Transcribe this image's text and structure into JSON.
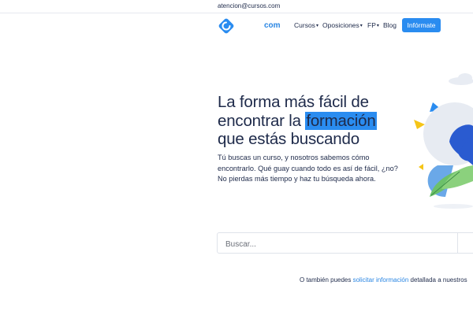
{
  "topbar": {
    "email": "atencion@cursos.com"
  },
  "header": {
    "brand": "com",
    "nav": [
      {
        "label": "Cursos",
        "has_dropdown": true
      },
      {
        "label": "Oposiciones",
        "has_dropdown": true
      },
      {
        "label": "FP",
        "has_dropdown": true
      },
      {
        "label": "Blog",
        "has_dropdown": false
      }
    ],
    "cta_label": "Infórmate"
  },
  "hero": {
    "title_line1": "La forma más fácil de",
    "title_line2_pre": "encontrar la ",
    "title_highlight": "formación",
    "title_line3": "que estás buscando",
    "subtitle": "Tú buscas un curso, y nosotros sabemos cómo encontrarlo. Qué guay cuando todo es así de fácil, ¿no? No pierdas más tiempo y haz tu búsqueda ahora."
  },
  "search": {
    "placeholder": "Buscar..."
  },
  "footer_note": {
    "pre": "O también puedes ",
    "link": "solicitar información",
    "post": " detallada a nuestros"
  },
  "colors": {
    "accent": "#2a8cf0",
    "text": "#1e2a4a"
  }
}
